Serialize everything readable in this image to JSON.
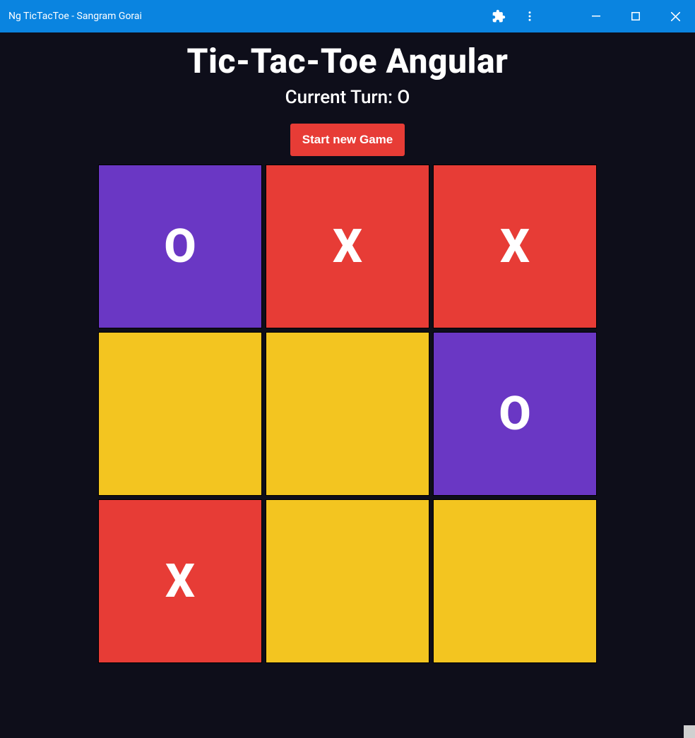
{
  "window": {
    "title": "Ng TicTacToe - Sangram Gorai"
  },
  "game": {
    "title": "Tic-Tac-Toe Angular",
    "turn_prefix": "Current Turn: ",
    "current_turn": "O",
    "start_button_label": "Start new Game"
  },
  "board": {
    "cells": [
      {
        "row": 0,
        "col": 0,
        "mark": "O"
      },
      {
        "row": 0,
        "col": 1,
        "mark": "X"
      },
      {
        "row": 0,
        "col": 2,
        "mark": "X"
      },
      {
        "row": 1,
        "col": 0,
        "mark": ""
      },
      {
        "row": 1,
        "col": 1,
        "mark": ""
      },
      {
        "row": 1,
        "col": 2,
        "mark": "O"
      },
      {
        "row": 2,
        "col": 0,
        "mark": "X"
      },
      {
        "row": 2,
        "col": 1,
        "mark": ""
      },
      {
        "row": 2,
        "col": 2,
        "mark": ""
      }
    ]
  },
  "colors": {
    "titlebar": "#0a84e0",
    "background": "#0e0e1a",
    "cell_empty": "#f3c520",
    "cell_O": "#6a37c4",
    "cell_X": "#e73c36",
    "start_button": "#e73c36"
  }
}
